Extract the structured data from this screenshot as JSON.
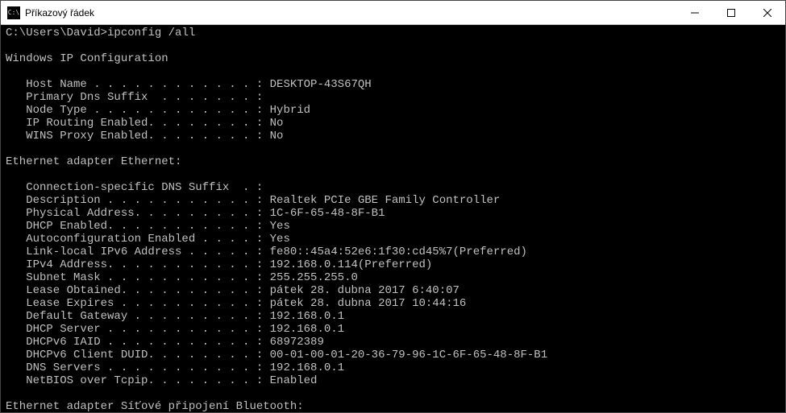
{
  "window": {
    "title": "Příkazový řádek",
    "icon_label": "C:\\"
  },
  "prompt": {
    "path": "C:\\Users\\David>",
    "command": "ipconfig /all"
  },
  "sections": {
    "ip_config_header": "Windows IP Configuration",
    "host_name": "   Host Name . . . . . . . . . . . . : DESKTOP-43S67QH",
    "primary_dns_suffix": "   Primary Dns Suffix  . . . . . . . :",
    "node_type": "   Node Type . . . . . . . . . . . . : Hybrid",
    "ip_routing": "   IP Routing Enabled. . . . . . . . : No",
    "wins_proxy": "   WINS Proxy Enabled. . . . . . . . : No",
    "eth_header": "Ethernet adapter Ethernet:",
    "conn_suffix": "   Connection-specific DNS Suffix  . :",
    "description": "   Description . . . . . . . . . . . : Realtek PCIe GBE Family Controller",
    "physical_addr": "   Physical Address. . . . . . . . . : 1C-6F-65-48-8F-B1",
    "dhcp_enabled": "   DHCP Enabled. . . . . . . . . . . : Yes",
    "autoconfig": "   Autoconfiguration Enabled . . . . : Yes",
    "link_local_ipv6": "   Link-local IPv6 Address . . . . . : fe80::45a4:52e6:1f30:cd45%7(Preferred)",
    "ipv4": "   IPv4 Address. . . . . . . . . . . : 192.168.0.114(Preferred)",
    "subnet": "   Subnet Mask . . . . . . . . . . . : 255.255.255.0",
    "lease_obtained": "   Lease Obtained. . . . . . . . . . : pátek 28. dubna 2017 6:40:07",
    "lease_expires": "   Lease Expires . . . . . . . . . . : pátek 28. dubna 2017 10:44:16",
    "default_gateway": "   Default Gateway . . . . . . . . . : 192.168.0.1",
    "dhcp_server": "   DHCP Server . . . . . . . . . . . : 192.168.0.1",
    "dhcpv6_iaid": "   DHCPv6 IAID . . . . . . . . . . . : 68972389",
    "dhcpv6_duid": "   DHCPv6 Client DUID. . . . . . . . : 00-01-00-01-20-36-79-96-1C-6F-65-48-8F-B1",
    "dns_servers": "   DNS Servers . . . . . . . . . . . : 192.168.0.1",
    "netbios": "   NetBIOS over Tcpip. . . . . . . . : Enabled",
    "bt_header": "Ethernet adapter Síťové připojení Bluetooth:"
  }
}
